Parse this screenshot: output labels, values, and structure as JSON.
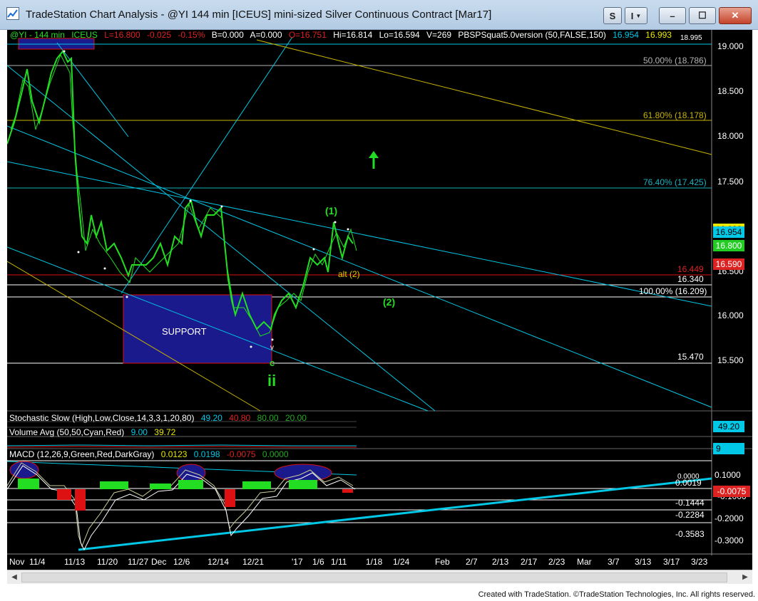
{
  "window": {
    "title": "TradeStation Chart Analysis - @YI 144 min [ICEUS] mini-sized Silver Continuous Contract [Mar17]",
    "buttons": {
      "s": "S",
      "i": "I",
      "min": "–",
      "max": "☐",
      "close": "✕"
    }
  },
  "header": {
    "symbol": "@YI - 144 min",
    "exchange": "ICEUS",
    "last": "L=16.800",
    "change": "-0.025",
    "pct": "-0.15%",
    "bid": "B=0.000",
    "ask": "A=0.000",
    "open": "O=16.751",
    "high": "Hi=16.814",
    "low": "Lo=16.594",
    "volume": "V=269",
    "study": "PBSPSquat5.0version (50,FALSE,150)",
    "study_v1": "16.954",
    "study_v2": "16.993"
  },
  "price_axis": [
    "19.000",
    "18.500",
    "18.000",
    "17.500",
    "16.500",
    "16.000",
    "15.500"
  ],
  "fib_labels": {
    "f50": "50.00% (18.786)",
    "f618": "61.80% (18.178)",
    "f764": "76.40% (17.425)",
    "f100": "100.00% (16.209)",
    "l16449": "16.449",
    "l16340": "16.340",
    "l15470": "15.470",
    "top_cut": "18.995"
  },
  "price_boxes": {
    "b1": "16.993",
    "b2": "16.954",
    "b3": "16.800",
    "b4": "16.590"
  },
  "annotations": {
    "support": "SUPPORT",
    "w1": "(1)",
    "alt2": "alt (2)",
    "w2": "(2)",
    "c": "c",
    "ii": "ii",
    "v": "v",
    "arrow": "↑"
  },
  "stochastic": {
    "label": "Stochastic Slow (High,Low,Close,14,3,3,1,20,80)",
    "v1": "49.20",
    "v2": "40.80",
    "v3": "80.00",
    "v4": "20.00",
    "box": "49.20"
  },
  "volume": {
    "label": "Volume Avg (50,50,Cyan,Red)",
    "v1": "9.00",
    "v2": "39.72",
    "box": "9"
  },
  "macd": {
    "label": "MACD (12,26,9,Green,Red,DarkGray)",
    "v1": "0.0123",
    "v2": "0.0198",
    "v3": "-0.0075",
    "v4": "0.0000",
    "axis": [
      "0.1000",
      "-0.1000",
      "-0.2000",
      "-0.3000"
    ],
    "l1": "0.0019",
    "l2": "-0.1444",
    "l3": "-0.2284",
    "l4": "-0.3583",
    "box": "-0.0075",
    "cut": "0.0000"
  },
  "date_axis": [
    "Nov",
    "11/4",
    "11/13",
    "11/20",
    "11/27",
    "Dec",
    "12/6",
    "12/14",
    "12/21",
    "'17",
    "1/6",
    "1/11",
    "1/18",
    "1/24",
    "Feb",
    "2/7",
    "2/13",
    "2/17",
    "2/23",
    "Mar",
    "3/7",
    "3/13",
    "3/17",
    "3/23"
  ],
  "footer": "Created with TradeStation. ©TradeStation Technologies, Inc. All rights reserved.",
  "colors": {
    "bull": "#22dd22",
    "cyan": "#00c8e6",
    "yellow": "#c8b400",
    "red": "#dd1111",
    "navy": "#1a1a8c"
  }
}
